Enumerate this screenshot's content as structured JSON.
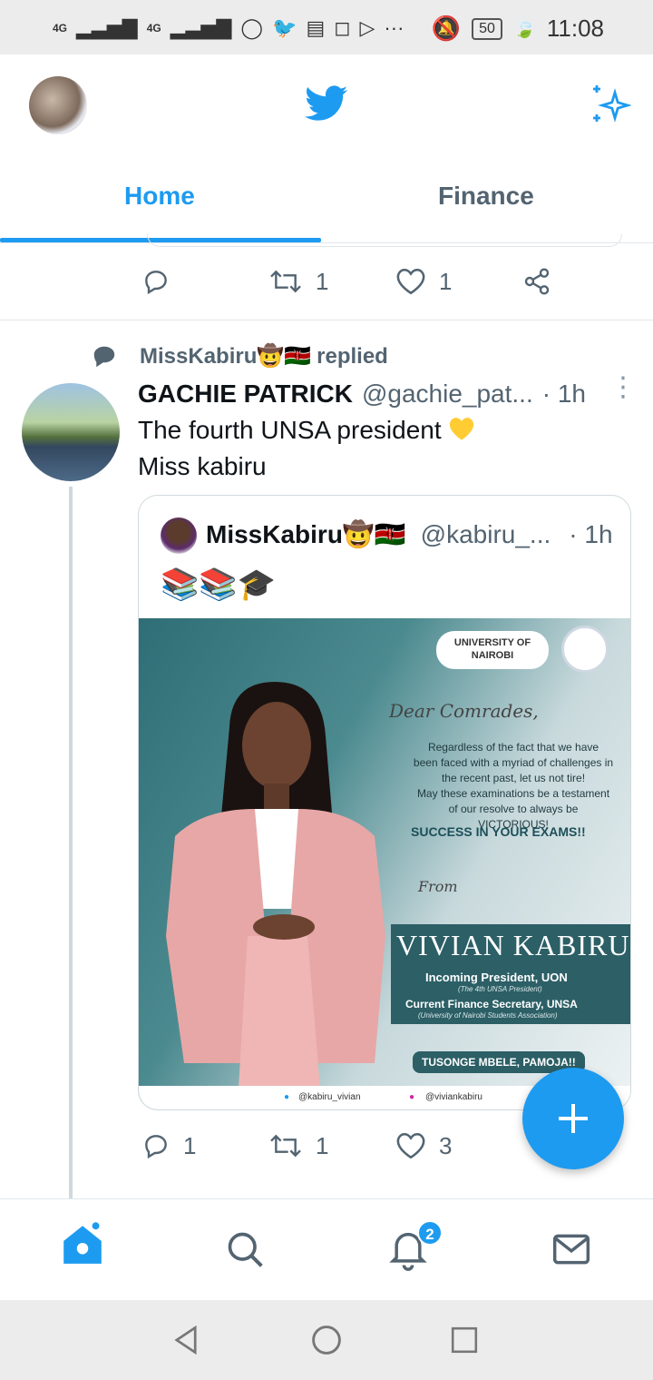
{
  "status_bar": {
    "network_left": "4G",
    "network_right": "4G",
    "battery": "50",
    "time": "11:08",
    "more": "···"
  },
  "header": {
    "tabs": [
      {
        "label": "Home",
        "active": true
      },
      {
        "label": "Finance",
        "active": false
      }
    ]
  },
  "prev_tweet": {
    "reply_count": "",
    "retweet_count": "1",
    "like_count": "1"
  },
  "tweet": {
    "social_context_name": "MissKabiru🤠🇰🇪",
    "social_context_action": "replied",
    "author_name": "GACHIE PATRICK",
    "author_handle": "@gachie_pat...",
    "time": "· 1h",
    "text_line1": "The fourth UNSA president",
    "text_line2": "Miss kabiru",
    "reply_count": "1",
    "retweet_count": "1",
    "like_count": "3"
  },
  "quoted": {
    "author_name": "MissKabiru🤠🇰🇪",
    "author_handle": "@kabiru_...",
    "time": "· 1h",
    "text": "📚📚🎓",
    "poster": {
      "logo_text": "UNIVERSITY OF NAIROBI",
      "dear": "Dear Comrades,",
      "message_1": "Regardless of the fact that we have",
      "message_2": "been faced with a myriad of challenges in",
      "message_3": "the recent past, let us not tire!",
      "message_4": "May these examinations be a testament",
      "message_5": "of our resolve to always be",
      "message_6": "VICTORIOUS!",
      "success": "SUCCESS IN YOUR EXAMS!!",
      "from": "From",
      "name": "VIVIAN KABIRU",
      "role_1": "Incoming President, UON",
      "role_1_sub": "(The 4th UNSA President)",
      "role_2": "Current Finance Secretary, UNSA",
      "role_2_sub": "(University of Nairobi Students Association)",
      "slogan": "TUSONGE MBELE, PAMOJA!!",
      "twitter": "@kabiru_vivian",
      "instagram": "@viviankabiru"
    }
  },
  "bottom_nav": {
    "notifications_badge": "2"
  },
  "colors": {
    "accent": "#1d9bf0",
    "muted": "#536471",
    "divider": "#e1e8ed"
  }
}
